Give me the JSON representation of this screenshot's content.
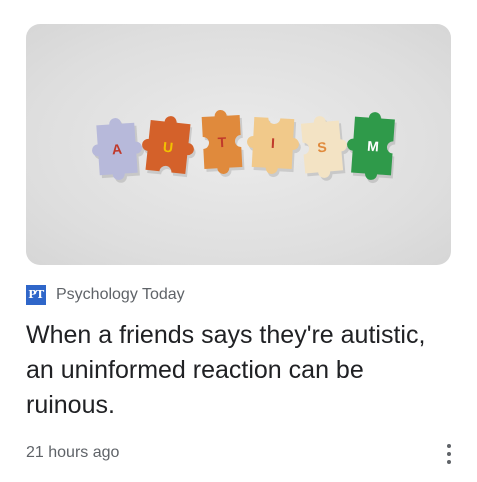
{
  "article": {
    "image": {
      "alt_icon": "autism-puzzle-pieces-image",
      "pieces": [
        {
          "letter": "A",
          "color": "#b7b9da",
          "letter_color": "#c0392b"
        },
        {
          "letter": "U",
          "color": "#d4612a",
          "letter_color": "#f2c200"
        },
        {
          "letter": "T",
          "color": "#e08a3c",
          "letter_color": "#c0392b"
        },
        {
          "letter": "I",
          "color": "#f1c98a",
          "letter_color": "#c0392b"
        },
        {
          "letter": "S",
          "color": "#f3e3c4",
          "letter_color": "#e08a3c"
        },
        {
          "letter": "M",
          "color": "#2f9a4a",
          "letter_color": "#ffffff"
        }
      ]
    },
    "source": {
      "logo_text": "PT",
      "logo_color": "#2f66c9",
      "name": "Psychology Today"
    },
    "headline": "When a friends says they're autistic, an uninformed reaction can be ruinous.",
    "timestamp": "21 hours ago",
    "more_icon": "more-vert-icon"
  }
}
